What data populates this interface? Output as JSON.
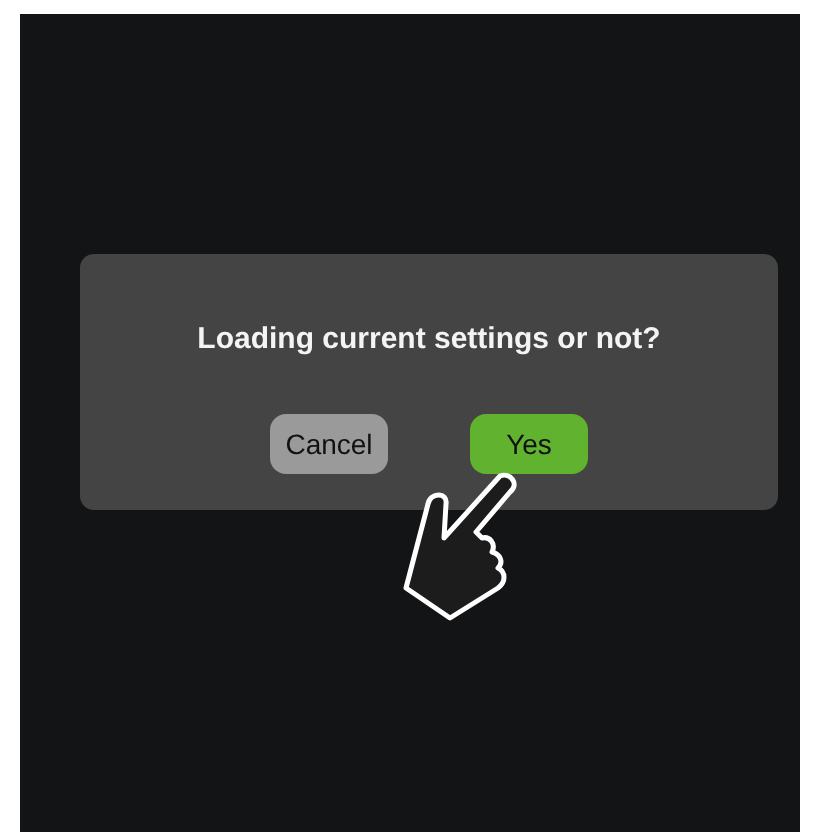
{
  "dialog": {
    "message": "Loading current settings or not?",
    "buttons": [
      {
        "label": "Cancel",
        "kind": "secondary"
      },
      {
        "label": "Yes",
        "kind": "primary"
      }
    ]
  }
}
